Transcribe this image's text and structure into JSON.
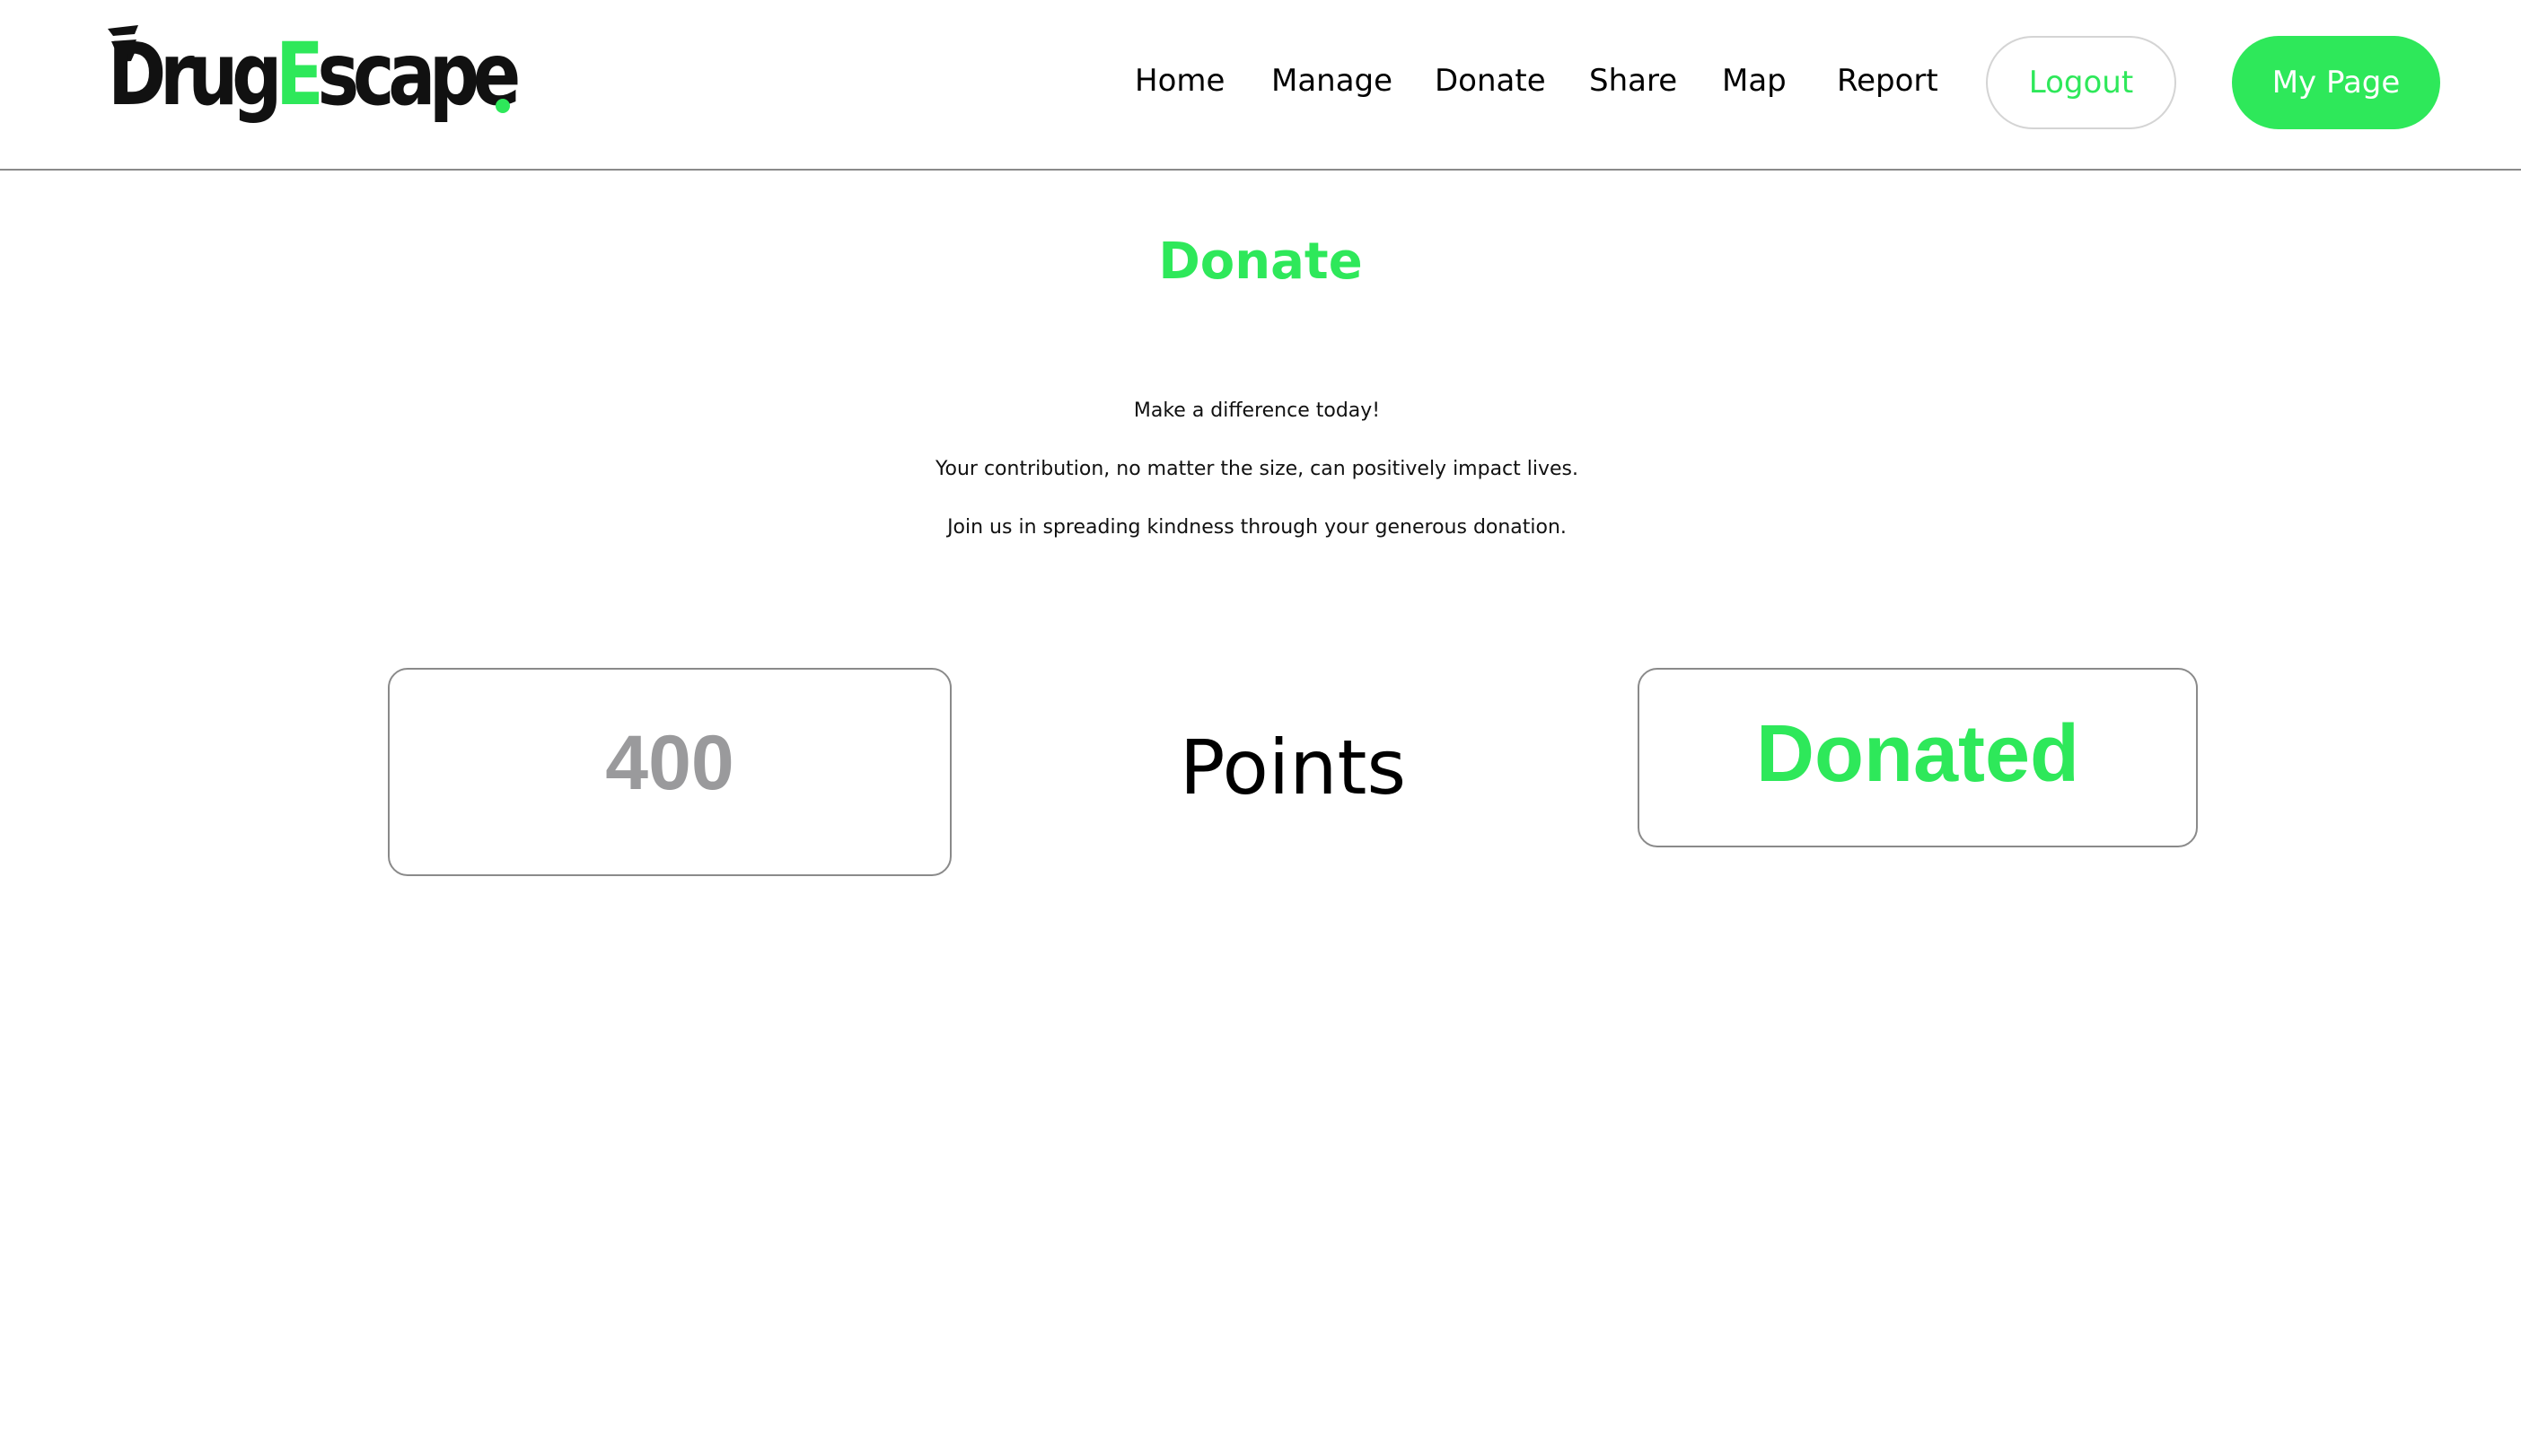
{
  "brand": {
    "logo_part1": "Drug",
    "logo_part2": "E",
    "logo_part3": "scape",
    "accent_color": "#2ee85a"
  },
  "nav": {
    "items": [
      {
        "label": "Home"
      },
      {
        "label": "Manage"
      },
      {
        "label": "Donate"
      },
      {
        "label": "Share"
      },
      {
        "label": "Map"
      },
      {
        "label": "Report"
      }
    ],
    "logout_label": "Logout",
    "mypage_label": "My Page"
  },
  "main": {
    "title": "Donate",
    "lines": [
      "Make a difference today!",
      "Your contribution, no matter the size, can positively impact lives.",
      "Join us in spreading kindness through your generous donation."
    ],
    "points_value": "400",
    "points_label": "Points",
    "donated_label": "Donated"
  }
}
